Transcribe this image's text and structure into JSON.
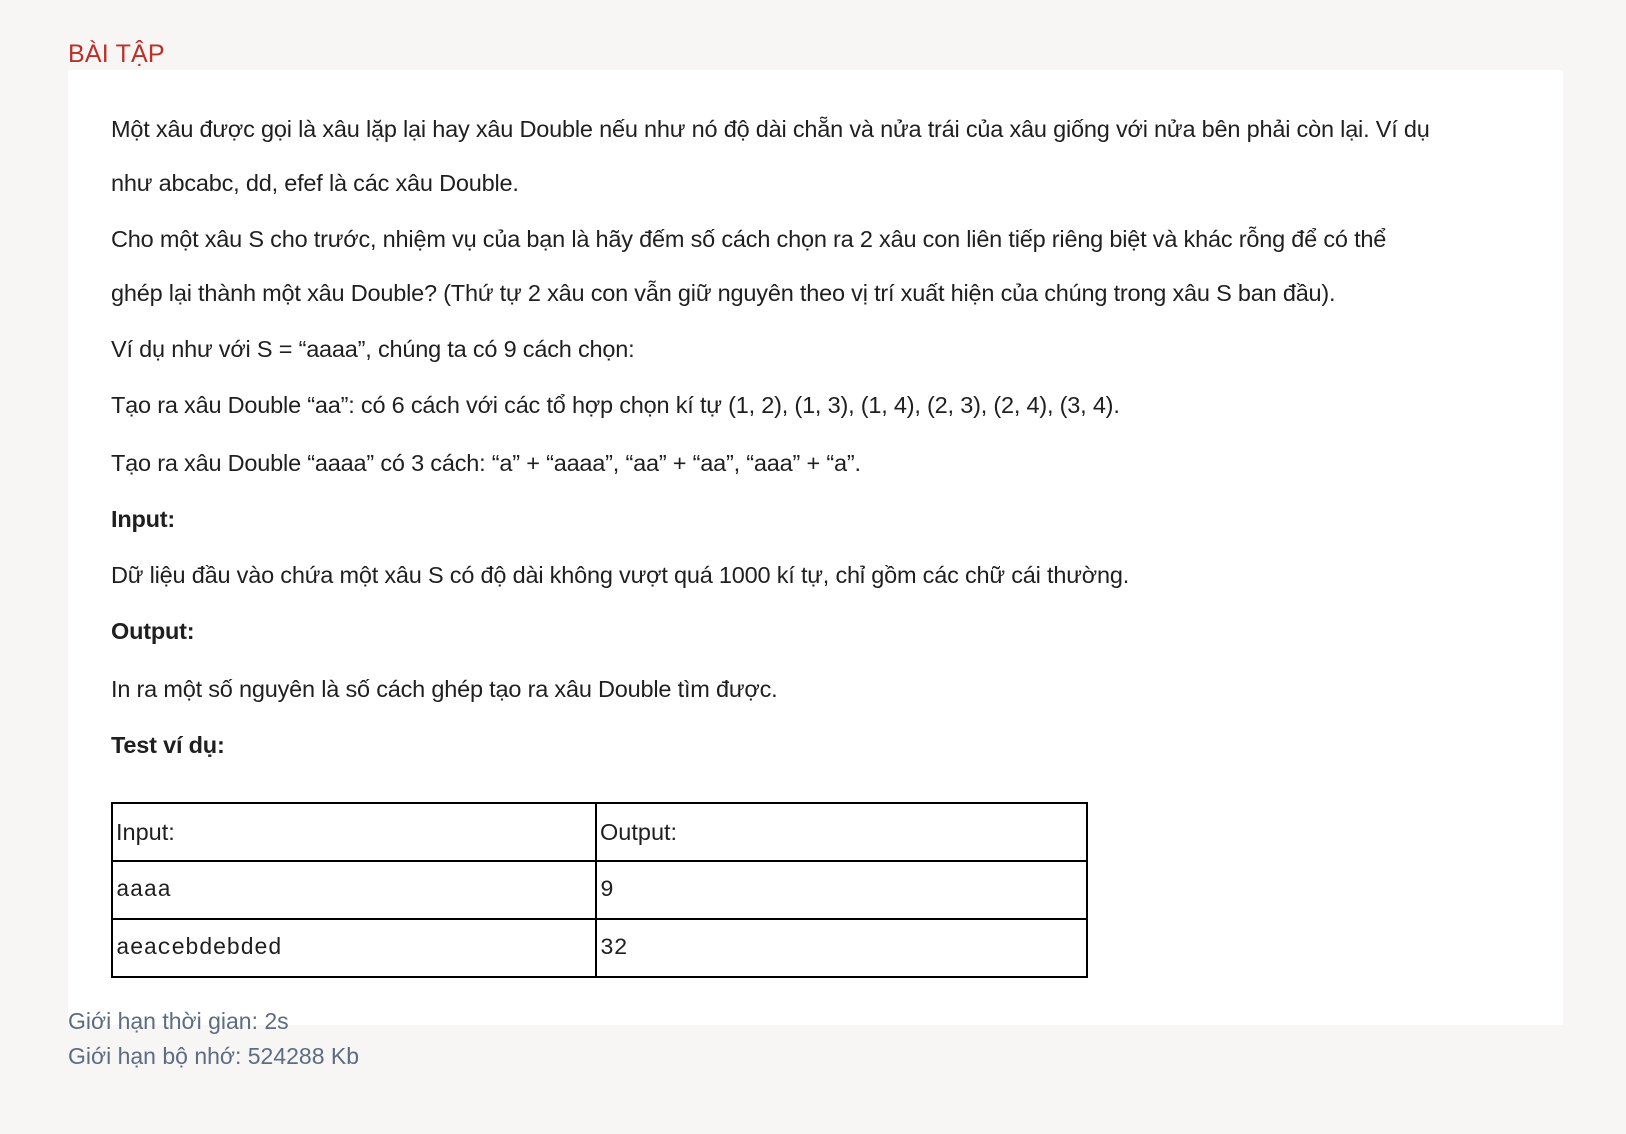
{
  "header": {
    "title": "BÀI TẬP"
  },
  "problem": {
    "paragraphs": [
      "Một xâu được gọi là xâu lặp lại hay xâu Double nếu như nó độ dài chẵn và nửa trái của xâu giống với nửa bên phải còn lại. Ví dụ",
      "như abcabc, dd, efef là các xâu Double.",
      "Cho một xâu S cho trước, nhiệm vụ của bạn là hãy đếm số cách chọn ra 2 xâu con liên tiếp riêng biệt và khác rỗng để có thể",
      "ghép lại thành một xâu Double? (Thứ tự 2 xâu con vẫn giữ nguyên theo vị trí xuất hiện của chúng trong xâu S ban đầu).",
      "Ví dụ như với S = “aaaa”, chúng ta có 9 cách chọn:",
      "Tạo ra xâu Double “aa”: có 6 cách với các tổ hợp chọn kí tự (1, 2), (1, 3), (1, 4), (2, 3), (2, 4), (3, 4).",
      "Tạo ra xâu Double “aaaa” có 3 cách: “a” + “aaaa”, “aa” + “aa”, “aaa” + “a”."
    ],
    "input_heading": "Input:",
    "input_text": "Dữ liệu đầu vào chứa một xâu S có độ dài không vượt quá 1000 kí tự, chỉ gồm các chữ cái thường.",
    "output_heading": "Output:",
    "output_text": "In ra một số nguyên là số cách ghép tạo ra xâu Double tìm được.",
    "test_heading": "Test ví dụ:"
  },
  "tests": {
    "headers": [
      "Input:",
      "Output:"
    ],
    "rows": [
      [
        "aaaa",
        "9"
      ],
      [
        "aeacebdebded",
        "32"
      ]
    ]
  },
  "limits": {
    "time": "Giới hạn thời gian: 2s",
    "memory": "Giới hạn bộ nhớ: 524288 Kb"
  },
  "colors": {
    "title": "#b8322a",
    "limits": "#5c6c82",
    "page_bg": "#f8f5f5",
    "card_bg": "#ffffff"
  }
}
